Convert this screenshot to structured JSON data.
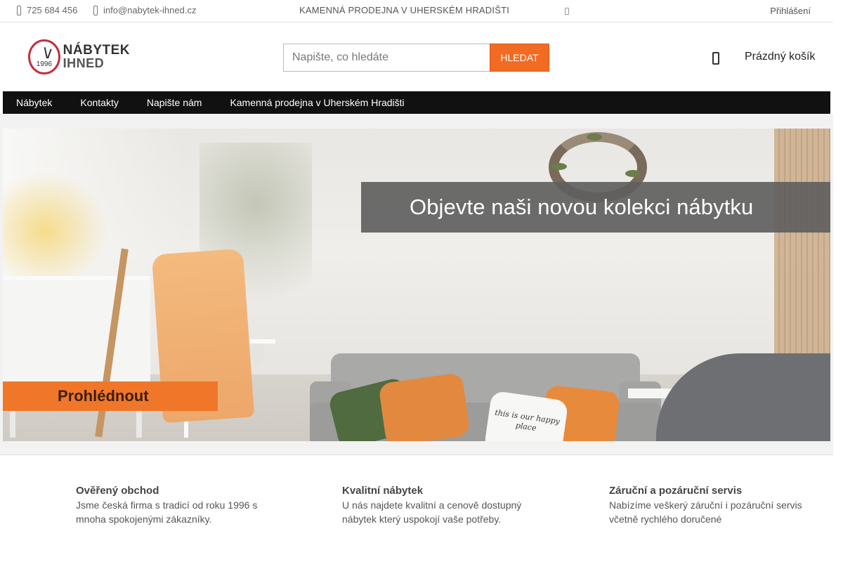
{
  "topbar": {
    "phone": "725 684 456",
    "email": "info@nabytek-ihned.cz",
    "store_notice": "KAMENNÁ PRODEJNA V UHERSKÉM HRADIŠTI",
    "login": "Přihlášení",
    "icons": [
      "phone-icon",
      "mail-icon",
      "info-icon"
    ]
  },
  "header": {
    "logo": {
      "line1": "NÁBYTEK",
      "line2": "IHNED",
      "year": "1996"
    },
    "search": {
      "placeholder": "Napište, co hledáte",
      "button": "HLEDAT"
    },
    "cart_label": "Prázdný košík"
  },
  "nav": {
    "items": [
      "Nábytek",
      "Kontakty",
      "Napište nám",
      "Kamenná prodejna v Uherském Hradišti"
    ]
  },
  "hero": {
    "headline": "Objevte naši novou kolekci nábytku",
    "cta": "Prohlédnout",
    "pillow_text": "this is our happy place"
  },
  "features": [
    {
      "title": "Ověřený obchod",
      "text": "Jsme česká firma s tradicí od roku 1996 s mnoha spokojenými zákazníky."
    },
    {
      "title": "Kvalitní nábytek",
      "text": "U nás najdete kvalitní a cenově dostupný nábytek který uspokojí vaše potřeby."
    },
    {
      "title": "Záruční a pozáruční servis",
      "text": "Nabízíme veškerý záruční i pozáruční servis včetně rychlého doručené"
    }
  ],
  "colors": {
    "accent": "#f26b22",
    "nav_bg": "#111111",
    "banner_bg": "#5f5f5f"
  }
}
